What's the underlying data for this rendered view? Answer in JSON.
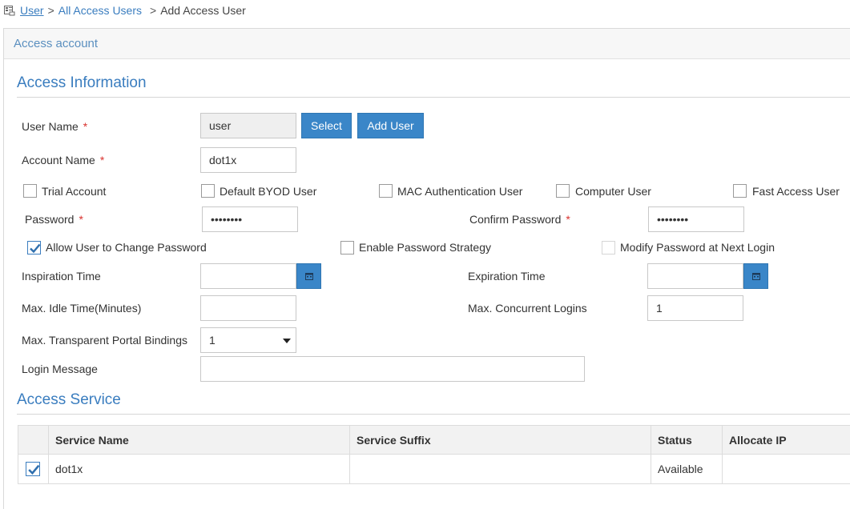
{
  "breadcrumb": {
    "items": [
      {
        "label": "User",
        "link": true
      },
      {
        "label": "All Access Users",
        "link": true
      },
      {
        "label": "Add Access User",
        "link": false
      }
    ],
    "separator": ">"
  },
  "card": {
    "title": "Access account"
  },
  "access_info": {
    "title": "Access Information",
    "user_name": {
      "label": "User Name",
      "value": "user",
      "select_btn": "Select",
      "add_btn": "Add User"
    },
    "account_name": {
      "label": "Account Name",
      "value": "dot1x"
    },
    "account_types": [
      {
        "label": "Trial Account",
        "checked": false
      },
      {
        "label": "Default BYOD User",
        "checked": false
      },
      {
        "label": "MAC Authentication User",
        "checked": false
      },
      {
        "label": "Computer User",
        "checked": false
      },
      {
        "label": "Fast Access User",
        "checked": false
      }
    ],
    "password": {
      "label": "Password",
      "value": "••••••••"
    },
    "confirm_password": {
      "label": "Confirm Password",
      "value": "••••••••"
    },
    "password_options": [
      {
        "label": "Allow User to Change Password",
        "checked": true,
        "disabled": false
      },
      {
        "label": "Enable Password Strategy",
        "checked": false,
        "disabled": false
      },
      {
        "label": "Modify Password at Next Login",
        "checked": false,
        "disabled": true
      }
    ],
    "inspiration_time": {
      "label": "Inspiration Time",
      "value": ""
    },
    "expiration_time": {
      "label": "Expiration Time",
      "value": ""
    },
    "max_idle": {
      "label": "Max. Idle Time(Minutes)",
      "value": ""
    },
    "max_concurrent": {
      "label": "Max. Concurrent Logins",
      "value": "1"
    },
    "max_portal": {
      "label": "Max. Transparent Portal Bindings",
      "value": "1"
    },
    "login_message": {
      "label": "Login Message",
      "value": ""
    },
    "required_mark": "*"
  },
  "access_service": {
    "title": "Access Service",
    "columns": [
      "Service Name",
      "Service Suffix",
      "Status",
      "Allocate IP"
    ],
    "rows": [
      {
        "checked": true,
        "service_name": "dot1x",
        "service_suffix": "",
        "status": "Available",
        "allocate_ip": ""
      }
    ]
  },
  "colors": {
    "accent": "#3a86c8",
    "link": "#3a7dbf",
    "required": "#d9322e"
  }
}
